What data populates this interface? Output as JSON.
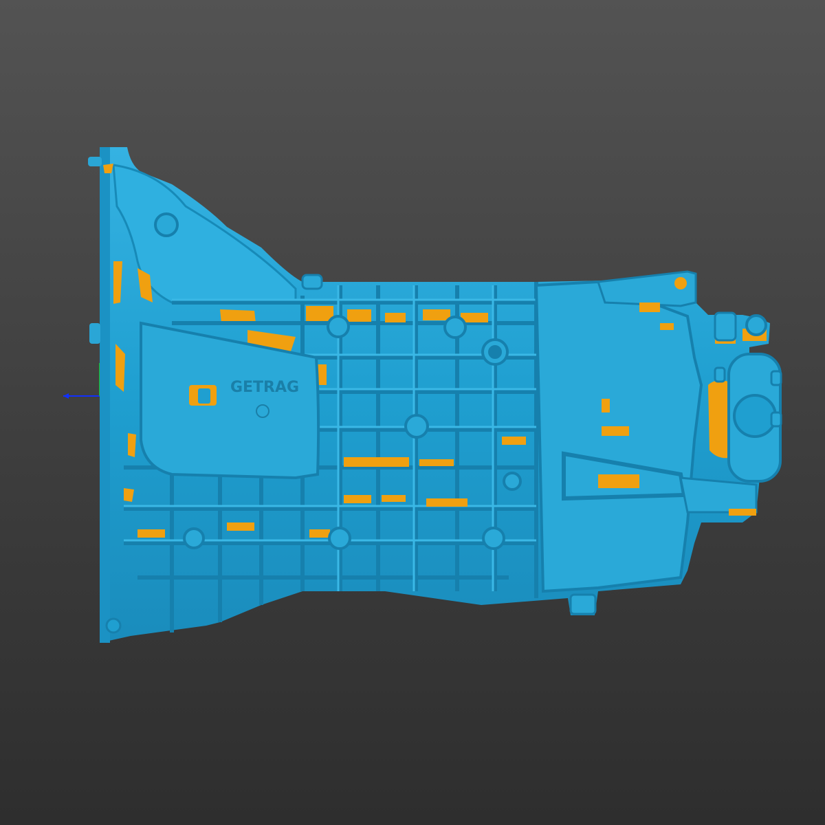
{
  "viewer": {
    "background_top": "#535353",
    "background_bottom": "#2e2e2e"
  },
  "model": {
    "description": "gearbox-3d-scan",
    "surface_color": "#1f9fd0",
    "shadow_color": "#1680ad",
    "highlight_color": "#3ab8e6",
    "backface_color": "#f0a010",
    "embossed_text": "GETRAG"
  },
  "axes": {
    "x_color": "#1030ff",
    "y_color": "#20c020"
  }
}
